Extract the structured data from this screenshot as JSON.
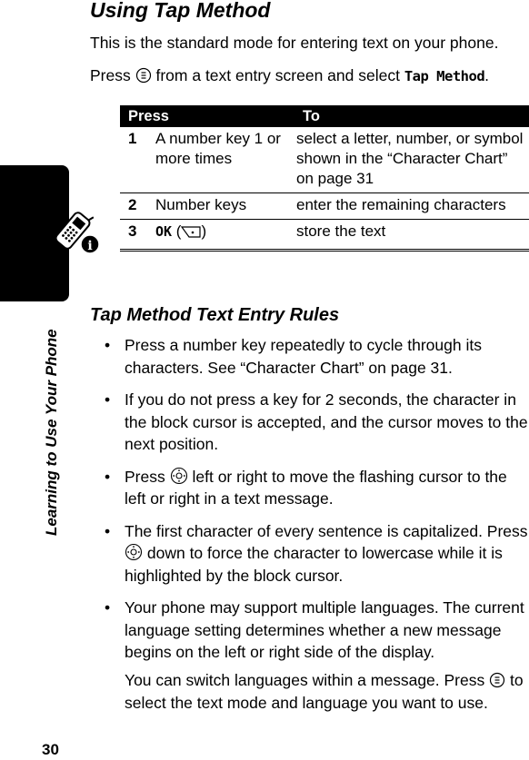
{
  "sidebar": {
    "section_label": "Learning to Use Your Phone",
    "icon": "phone-info-icon"
  },
  "page_number": "30",
  "section": {
    "title": "Using Tap Method",
    "intro": "This is the standard mode for entering text on your phone.",
    "instruction": {
      "prefix": "Press",
      "icon": "menu-key-icon",
      "middle": "from a text entry screen and select",
      "menu_option": "Tap Method",
      "suffix": "."
    }
  },
  "table": {
    "headers": [
      "Press",
      "To"
    ],
    "rows": [
      {
        "num": "1",
        "press": "A number key 1 or more times",
        "to": "select a letter, number, or symbol shown in the “Character Chart” on page 31"
      },
      {
        "num": "2",
        "press": "Number keys",
        "to": "enter the remaining characters"
      },
      {
        "num": "3",
        "press_key": "OK",
        "press_icon": "soft-key-icon",
        "to": "store the text"
      }
    ]
  },
  "rules": {
    "title": "Tap Method Text Entry Rules",
    "bullet": "•",
    "items": [
      {
        "text": "Press a number key repeatedly to cycle through its characters. See “Character Chart” on page 31."
      },
      {
        "text": "If you do not press a key for 2 seconds, the character in the block cursor is accepted, and the cursor moves to the next position."
      },
      {
        "prefix": "Press",
        "icon": "nav-key-icon",
        "text": "left or right to move the flashing cursor to the left or right in a text message."
      },
      {
        "text_before": "The first character of every sentence is capitalized. Press",
        "icon": "nav-key-icon",
        "text": "down to force the character to lowercase while it is highlighted by the block cursor."
      },
      {
        "text": "Your phone may support multiple languages. The current language setting determines whether a new message begins on the left or right side of the display."
      }
    ],
    "extra": {
      "text_before": "You can switch languages within a message. Press",
      "icon": "menu-key-icon",
      "text_after": "to select the text mode and language you want to use."
    }
  }
}
